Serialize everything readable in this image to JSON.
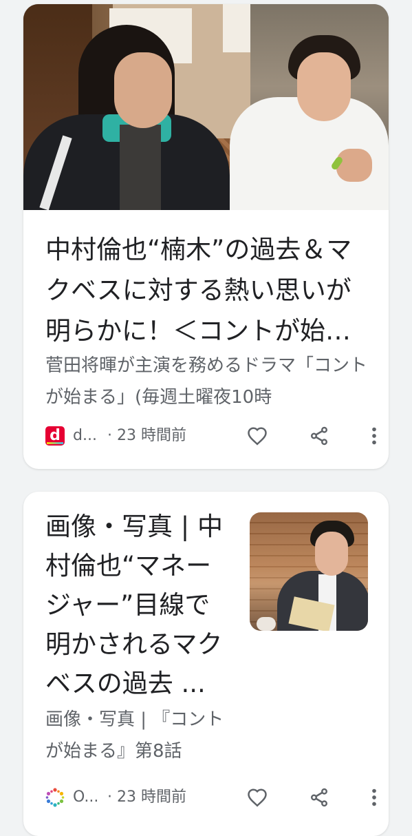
{
  "feed": {
    "cards": [
      {
        "title": "中村倫也“楠木”の過去＆マクベスに対する熱い思いが明らかに！＜コントが始まる＞",
        "snippet": "菅田将暉が主演を務めるドラマ「コントが始まる」(毎週土曜夜10時",
        "source": "d...",
        "time": "· 23 時間前",
        "source_icon": "d-icon",
        "image": "two-men-in-restaurant-photo"
      },
      {
        "title": "画像・写真 | 中村倫也“マネージャー”目線で明かされるマクベスの過去 ...",
        "snippet": "画像・写真 | 『コントが始まる』第8話",
        "source": "O...",
        "time": "· 23 時間前",
        "source_icon": "oricon-icon",
        "image": "man-in-suit-thumbnail"
      }
    ],
    "actions": {
      "like": "heart-icon",
      "share": "share-icon",
      "more": "more-vert-icon"
    }
  },
  "colors": {
    "background": "#f1f3f4",
    "card": "#ffffff",
    "title": "#202124",
    "secondary": "#5f6368",
    "d_brand": "#e60033"
  }
}
